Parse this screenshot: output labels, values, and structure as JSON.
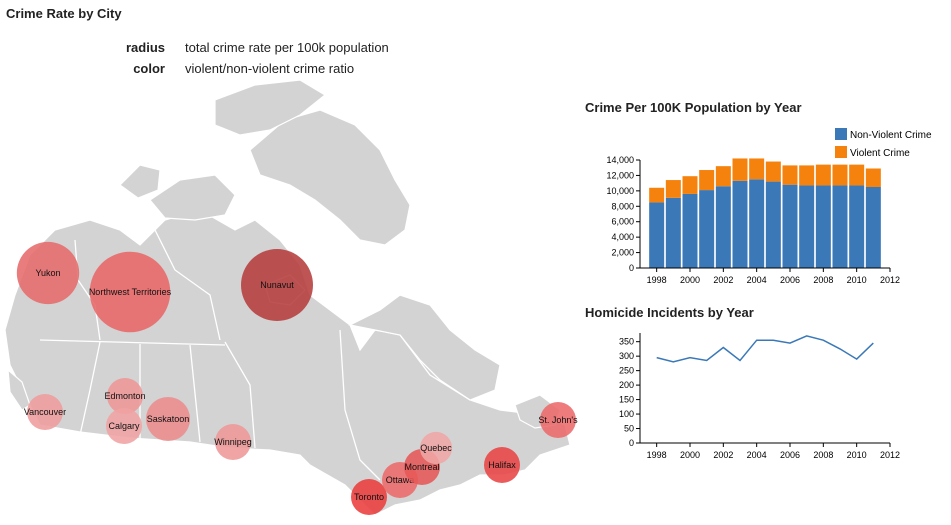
{
  "page_title": "Crime Rate by City",
  "legend": [
    {
      "key": "radius",
      "description": "total crime rate per 100k population"
    },
    {
      "key": "color",
      "description": "violent/non-violent crime ratio"
    }
  ],
  "colors": {
    "land": "#d3d3d3",
    "border": "#ffffff",
    "non_violent": "#3a78b8",
    "violent": "#f5820d",
    "line": "#3a78b8"
  },
  "chart_data": [
    {
      "type": "bubble-map",
      "title": "",
      "cities": [
        {
          "name": "Yukon",
          "size": 3,
          "color": "#e66a6a"
        },
        {
          "name": "Northwest Territories",
          "size": 5,
          "color": "#e86666"
        },
        {
          "name": "Nunavut",
          "size": 4,
          "color": "#b53c3c"
        },
        {
          "name": "Vancouver",
          "size": 1,
          "color": "#ee9c9c"
        },
        {
          "name": "Edmonton",
          "size": 1,
          "color": "#ee9696"
        },
        {
          "name": "Calgary",
          "size": 1,
          "color": "#f0a3a3"
        },
        {
          "name": "Saskatoon",
          "size": 1.5,
          "color": "#ec8c8c"
        },
        {
          "name": "Winnipeg",
          "size": 1,
          "color": "#ee9797"
        },
        {
          "name": "Toronto",
          "size": 1,
          "color": "#ea3c3c"
        },
        {
          "name": "Ottawa",
          "size": 1,
          "color": "#ec6a6a"
        },
        {
          "name": "Montreal",
          "size": 1,
          "color": "#e65858"
        },
        {
          "name": "Quebec",
          "size": 0.8,
          "color": "#f0a6a6"
        },
        {
          "name": "Halifax",
          "size": 1,
          "color": "#e84444"
        },
        {
          "name": "St. John's",
          "size": 1,
          "color": "#ec6a6a"
        }
      ]
    },
    {
      "type": "bar",
      "stacked": true,
      "title": "Crime Per 100K Population by Year",
      "x": [
        1998,
        1999,
        2000,
        2001,
        2002,
        2003,
        2004,
        2005,
        2006,
        2007,
        2008,
        2009,
        2010,
        2011
      ],
      "series": [
        {
          "name": "Non-Violent Crime",
          "color": "#3a78b8",
          "values": [
            8500,
            9100,
            9600,
            10100,
            10600,
            11300,
            11500,
            11200,
            10800,
            10700,
            10700,
            10700,
            10700,
            10500
          ]
        },
        {
          "name": "Violent Crime",
          "color": "#f5820d",
          "values": [
            1900,
            2300,
            2300,
            2600,
            2600,
            2900,
            2700,
            2600,
            2500,
            2600,
            2700,
            2700,
            2700,
            2400
          ]
        }
      ],
      "ylim": [
        0,
        14000
      ],
      "yticks": [
        0,
        2000,
        4000,
        6000,
        8000,
        10000,
        12000,
        14000
      ],
      "xlim": [
        1997,
        2012
      ],
      "xticks": [
        1998,
        2000,
        2002,
        2004,
        2006,
        2008,
        2010,
        2012
      ],
      "ytick_labels": [
        "0",
        "2,000",
        "4,000",
        "6,000",
        "8,000",
        "10,000",
        "12,000",
        "14,000"
      ],
      "legend_position": "top-right"
    },
    {
      "type": "line",
      "title": "Homicide Incidents by Year",
      "x": [
        1998,
        1999,
        2000,
        2001,
        2002,
        2003,
        2004,
        2005,
        2006,
        2007,
        2008,
        2009,
        2010,
        2011
      ],
      "series": [
        {
          "values": [
            295,
            280,
            295,
            285,
            330,
            285,
            355,
            355,
            345,
            370,
            355,
            325,
            290,
            345
          ]
        }
      ],
      "ylim": [
        0,
        380
      ],
      "yticks": [
        0,
        50,
        100,
        150,
        200,
        250,
        300,
        350
      ],
      "xlim": [
        1997,
        2012
      ],
      "xticks": [
        1998,
        2000,
        2002,
        2004,
        2006,
        2008,
        2010,
        2012
      ]
    }
  ]
}
